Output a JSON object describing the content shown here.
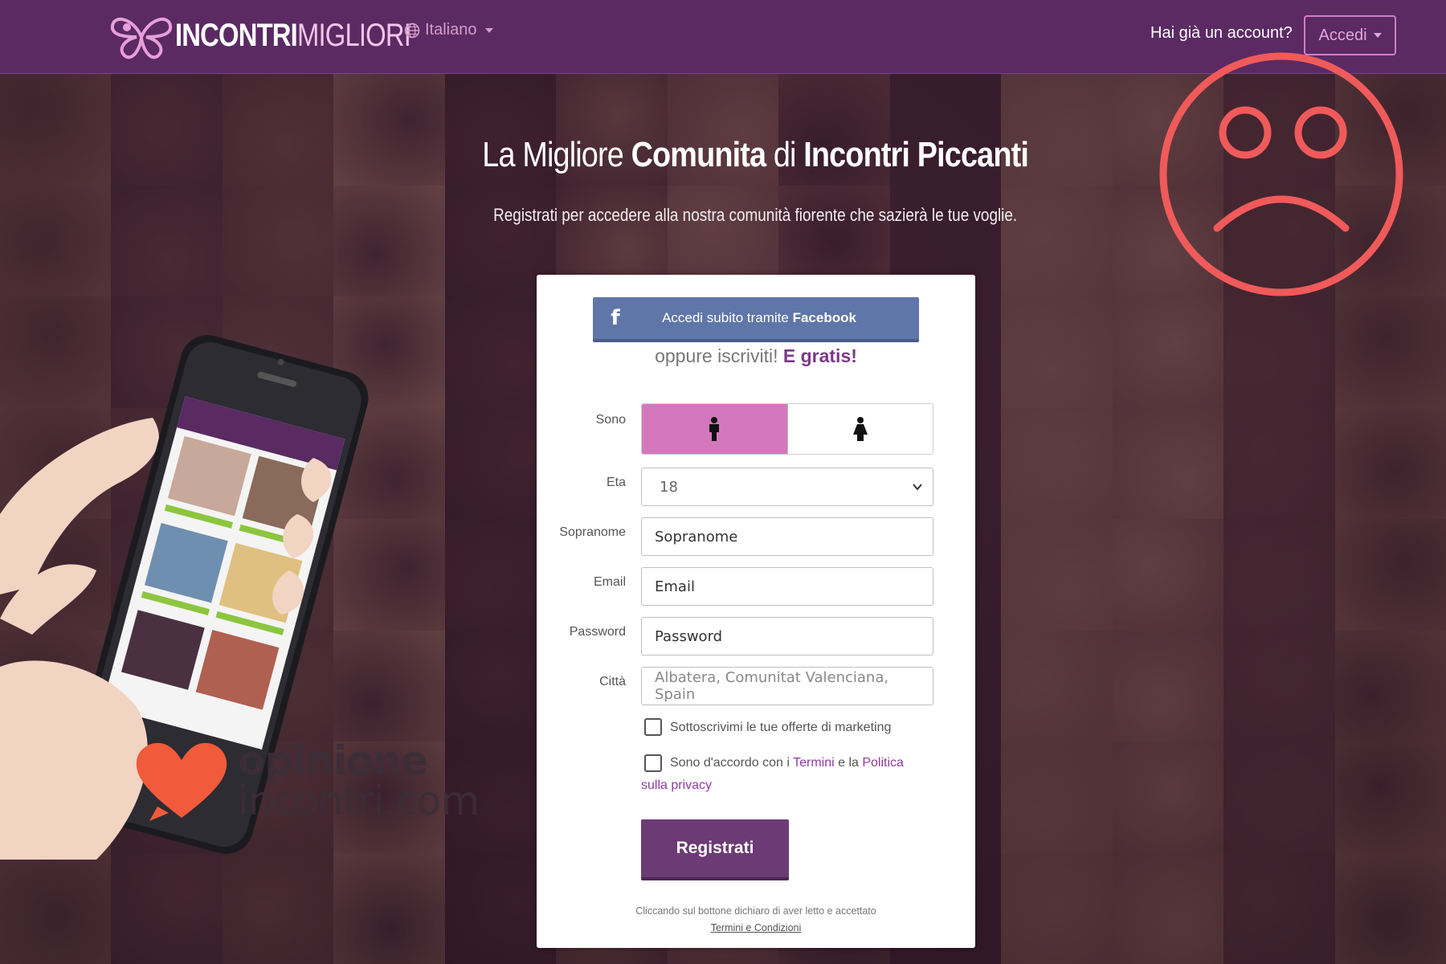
{
  "header": {
    "logo_bold": "INCONTRI",
    "logo_light": "MIGLIORI",
    "language": "Italiano",
    "account_question": "Hai già un account?",
    "login_button": "Accedi"
  },
  "hero": {
    "title_part1": "La Migliore ",
    "title_bold1": "Comunita",
    "title_part2": " di ",
    "title_bold2": "Incontri Piccanti",
    "subtitle": "Registrati per accedere alla nostra comunità fiorente che sazierà le tue voglie."
  },
  "form": {
    "facebook_prefix": "Accedi subito tramite ",
    "facebook_bold": "Facebook",
    "or_text": "oppure iscriviti! ",
    "or_bold": "E gratis!",
    "labels": {
      "sono": "Sono",
      "eta": "Eta",
      "nickname": "Sopranome",
      "email": "Email",
      "password": "Password",
      "city": "Città"
    },
    "gender_selected": "male",
    "age_value": "18",
    "nickname_placeholder": "Sopranome",
    "email_placeholder": "Email",
    "password_placeholder": "Password",
    "city_value": "Albatera, Comunitat Valenciana, Spain",
    "marketing_checkbox": "Sottoscrivimi le tue offerte di marketing",
    "terms_prefix": "Sono d'accordo con i ",
    "terms_link": "Termini",
    "terms_middle": " e la ",
    "privacy_link1": "Politica",
    "privacy_link2": "sulla privacy",
    "submit": "Registrati",
    "disclaimer": "Cliccando sul bottone dichiaro di aver letto e accettato",
    "disclaimer_link": "Termini e Condizioni"
  },
  "watermark": {
    "line1": "opinione",
    "line2": "incontri.com"
  },
  "colors": {
    "header_bg": "#5b2a63",
    "accent_pink": "#d478bd",
    "submit_bg": "#6c3a75",
    "facebook_bg": "#5f76a8",
    "sad_face": "#f05a5a",
    "watermark_heart": "#f15a3a"
  }
}
